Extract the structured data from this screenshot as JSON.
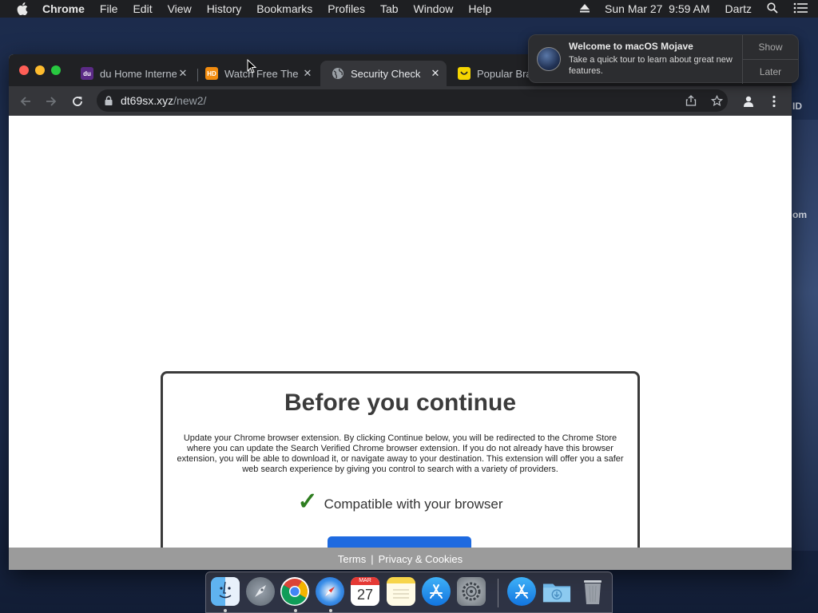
{
  "menubar": {
    "app_name": "Chrome",
    "items": [
      "File",
      "Edit",
      "View",
      "History",
      "Bookmarks",
      "Profiles",
      "Tab",
      "Window",
      "Help"
    ],
    "datetime": "Sun Mar 27  9:59 AM",
    "user": "Dartz"
  },
  "notification": {
    "title": "Welcome to macOS Mojave",
    "body": "Take a quick tour to learn about great new features.",
    "show_label": "Show",
    "later_label": "Later"
  },
  "desktop": {
    "partial_text_1": "ID",
    "partial_text_2": "om"
  },
  "browser": {
    "tabs": [
      {
        "title": "du Home Interne",
        "favicon": "du-favicon",
        "color": "#5b2a86",
        "fav_text": "du"
      },
      {
        "title": "Watch Free The",
        "favicon": "hd-favicon",
        "color": "#f28c0f",
        "fav_text": "HD"
      },
      {
        "title": "Security Check",
        "favicon": "globe-icon",
        "color": "#9aa0a6",
        "fav_text": ""
      },
      {
        "title": "Popular Bran",
        "favicon": "smile-favicon",
        "color": "#f5d500",
        "fav_text": ""
      }
    ],
    "url_host": "dt69sx.xyz",
    "url_path": "/new2/"
  },
  "page": {
    "heading": "Before you continue",
    "description": "Update your Chrome browser extension. By clicking Continue below, you will be redirected to the Chrome Store where you can update the Search Verified Chrome browser extension. If you do not already have this browser extension, you will be able to download it, or navigate away to your destination. This extension will offer you a safer web search experience by giving you control to search with a variety of providers.",
    "check_glyph": "✓",
    "compat_text": "Compatible with your browser",
    "footer_terms": "Terms",
    "footer_sep": "|",
    "footer_privacy": "Privacy & Cookies"
  },
  "dock": {
    "calendar_month": "MAR",
    "calendar_day": "27"
  },
  "colors": {
    "accent_button": "#1e6ae0",
    "check_green": "#2e7d1f",
    "footer_gray": "#9b9b9b"
  }
}
